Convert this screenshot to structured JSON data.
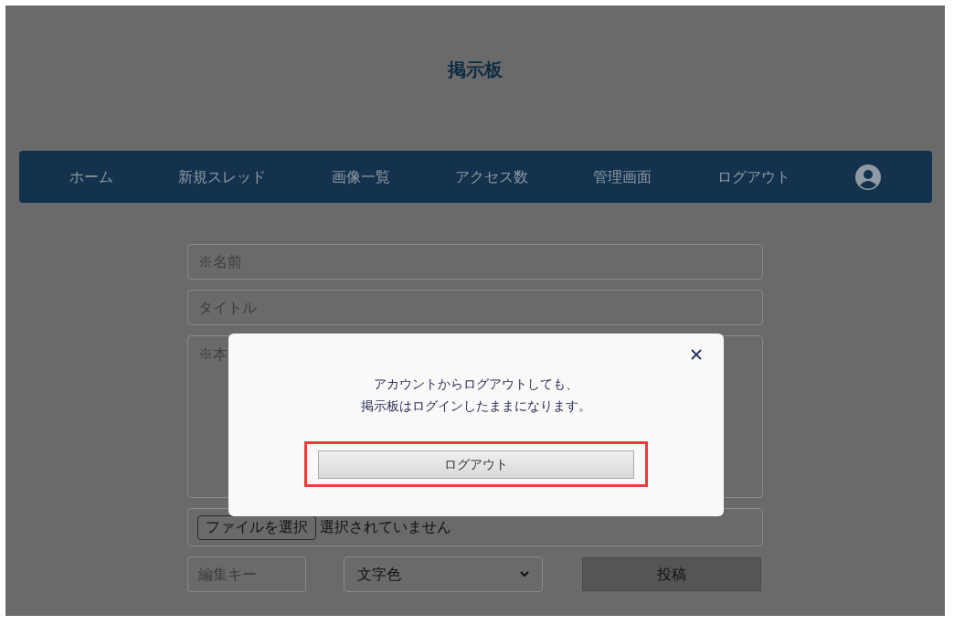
{
  "page": {
    "title": "掲示板"
  },
  "nav": {
    "items": [
      {
        "label": "ホーム"
      },
      {
        "label": "新規スレッド"
      },
      {
        "label": "画像一覧"
      },
      {
        "label": "アクセス数"
      },
      {
        "label": "管理画面"
      },
      {
        "label": "ログアウト"
      }
    ]
  },
  "form": {
    "name": {
      "placeholder": "※名前"
    },
    "title": {
      "placeholder": "タイトル"
    },
    "body": {
      "placeholder": "※本"
    },
    "file": {
      "button": "ファイルを選択",
      "status": "選択されていません"
    },
    "edit_key": {
      "placeholder": "編集キー"
    },
    "color_select": {
      "value": "文字色"
    },
    "submit": "投稿"
  },
  "dialog": {
    "message": [
      "アカウントからログアウトしても、",
      "掲示板はログインしたままになります。"
    ],
    "button": {
      "label": "ログアウト",
      "highlighted": true
    }
  }
}
